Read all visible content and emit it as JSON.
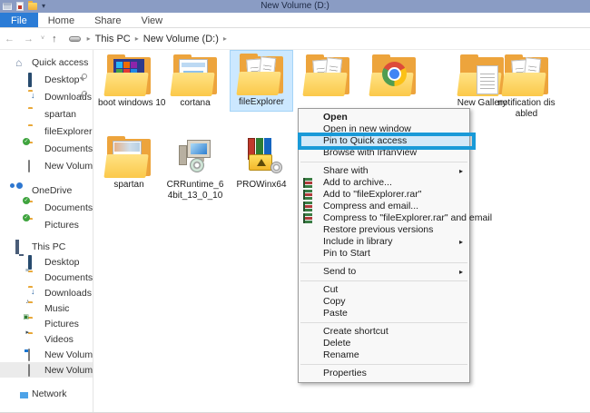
{
  "window": {
    "title": "New Volume (D:)",
    "qat_dropdown": "▾"
  },
  "ribbon": {
    "file_tab": "File",
    "tabs": [
      "Home",
      "Share",
      "View"
    ]
  },
  "address_bar": {
    "back": "←",
    "forward": "→",
    "recent": "˅",
    "up": "↑",
    "crumb_sep": "▸",
    "breadcrumb_root": "This PC",
    "breadcrumb_current": "New Volume (D:)"
  },
  "sidebar": {
    "quick_access": {
      "label": "Quick access",
      "items": [
        {
          "label": "Desktop"
        },
        {
          "label": "Downloads"
        },
        {
          "label": "spartan"
        },
        {
          "label": "fileExplorer"
        },
        {
          "label": "Documents"
        },
        {
          "label": "New Volume (D:)"
        }
      ]
    },
    "onedrive": {
      "label": "OneDrive",
      "items": [
        {
          "label": "Documents"
        },
        {
          "label": "Pictures"
        }
      ]
    },
    "this_pc": {
      "label": "This PC",
      "items": [
        {
          "label": "Desktop"
        },
        {
          "label": "Documents"
        },
        {
          "label": "Downloads"
        },
        {
          "label": "Music"
        },
        {
          "label": "Pictures"
        },
        {
          "label": "Videos"
        },
        {
          "label": "New Volume (C:)"
        },
        {
          "label": "New Volume (D:)"
        }
      ]
    },
    "network": {
      "label": "Network"
    }
  },
  "files": {
    "row1": [
      {
        "label": "boot windows 10"
      },
      {
        "label": "cortana"
      },
      {
        "label": "fileExplorer"
      },
      {
        "label": ""
      },
      {
        "label": ""
      },
      {
        "label": "New Gallery"
      },
      {
        "label": "notification disabled"
      }
    ],
    "row2": [
      {
        "label": "spartan"
      },
      {
        "label": "CRRuntime_64bit_13_0_10"
      },
      {
        "label": "PROWinx64"
      }
    ]
  },
  "context_menu": {
    "items": [
      {
        "label": "Open"
      },
      {
        "label": "Open in new window"
      },
      {
        "label": "Pin to Quick access"
      },
      {
        "label": "Browse with IrfanView"
      },
      {
        "label": "Share with"
      },
      {
        "label": "Add to archive..."
      },
      {
        "label": "Add to \"fileExplorer.rar\""
      },
      {
        "label": "Compress and email..."
      },
      {
        "label": "Compress to \"fileExplorer.rar\" and email"
      },
      {
        "label": "Restore previous versions"
      },
      {
        "label": "Include in library"
      },
      {
        "label": "Pin to Start"
      },
      {
        "label": "Send to"
      },
      {
        "label": "Cut"
      },
      {
        "label": "Copy"
      },
      {
        "label": "Paste"
      },
      {
        "label": "Create shortcut"
      },
      {
        "label": "Delete"
      },
      {
        "label": "Rename"
      },
      {
        "label": "Properties"
      }
    ],
    "submenu_arrow": "▸"
  },
  "colors": {
    "titlebar": "#8a9cc4",
    "file_tab": "#2b7cd6",
    "selection": "#cce8ff",
    "highlight_border": "#199ad8"
  }
}
